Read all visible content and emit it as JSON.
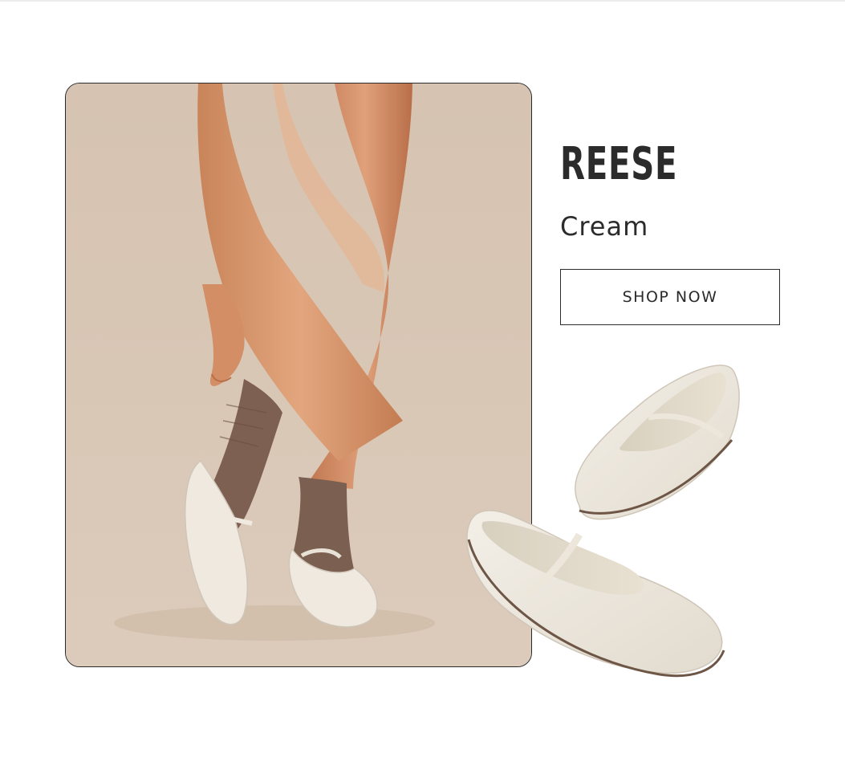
{
  "product": {
    "name": "REESE",
    "color": "Cream",
    "cta_label": "SHOP NOW"
  },
  "colors": {
    "text": "#2b2b2b",
    "photo_background": "#d9c6b4",
    "shoe_cream": "#efe9df",
    "sock_brown": "#7b5f51",
    "skin": "#d89a72"
  }
}
